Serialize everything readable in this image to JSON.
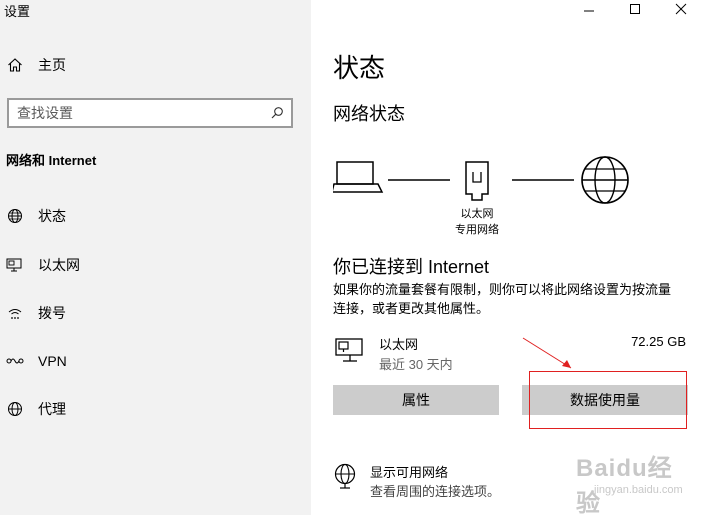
{
  "app": {
    "title": "设置"
  },
  "sidebar": {
    "home_label": "主页",
    "search_placeholder": "查找设置",
    "section_title": "网络和 Internet",
    "items": [
      {
        "label": "状态",
        "icon": "globe-icon"
      },
      {
        "label": "以太网",
        "icon": "ethernet-icon"
      },
      {
        "label": "拨号",
        "icon": "dialup-icon"
      },
      {
        "label": "VPN",
        "icon": "vpn-icon"
      },
      {
        "label": "代理",
        "icon": "globe-icon"
      }
    ]
  },
  "main": {
    "title": "状态",
    "network_status_heading": "网络状态",
    "diagram": {
      "adapter_label_line1": "以太网",
      "adapter_label_line2": "专用网络"
    },
    "connected_heading": "你已连接到 Internet",
    "connected_desc_line1": "如果你的流量套餐有限制，则你可以将此网络设置为按流量",
    "connected_desc_line2": "连接，或者更改其他属性。",
    "connection": {
      "name": "以太网",
      "period": "最近 30 天内",
      "usage": "72.25 GB"
    },
    "buttons": {
      "properties": "属性",
      "data_usage": "数据使用量"
    },
    "show_available": {
      "title": "显示可用网络",
      "desc": "查看周围的连接选项。"
    }
  },
  "watermark": {
    "text": "Baidu经验",
    "sub": "jingyan.baidu.com"
  },
  "colors": {
    "sidebar_bg": "#f2f2f2",
    "button_bg": "#cccccc",
    "annotation": "#e02020"
  }
}
